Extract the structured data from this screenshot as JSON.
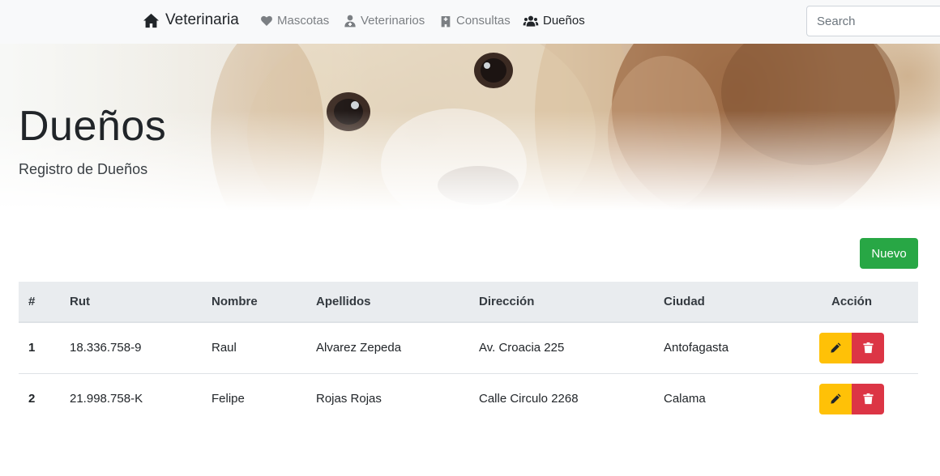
{
  "navbar": {
    "brand": "Veterinaria",
    "items": [
      {
        "label": "Mascotas",
        "icon": "heart-icon"
      },
      {
        "label": "Veterinarios",
        "icon": "user-md-icon"
      },
      {
        "label": "Consultas",
        "icon": "hospital-icon"
      },
      {
        "label": "Dueños",
        "icon": "users-icon",
        "active": true
      }
    ],
    "search_placeholder": "Search"
  },
  "hero": {
    "title": "Dueños",
    "subtitle": "Registro de Dueños"
  },
  "toolbar": {
    "new_label": "Nuevo"
  },
  "table": {
    "headers": [
      "#",
      "Rut",
      "Nombre",
      "Apellidos",
      "Dirección",
      "Ciudad",
      "Acción"
    ],
    "rows": [
      [
        "1",
        "18.336.758-9",
        "Raul",
        "Alvarez Zepeda",
        "Av. Croacia 225",
        "Antofagasta"
      ],
      [
        "2",
        "21.998.758-K",
        "Felipe",
        "Rojas Rojas",
        "Calle Circulo 2268",
        "Calama"
      ]
    ]
  },
  "colors": {
    "success": "#28a745",
    "warning": "#ffc107",
    "danger": "#dc3545",
    "navbar_bg": "#f8f9fa"
  }
}
